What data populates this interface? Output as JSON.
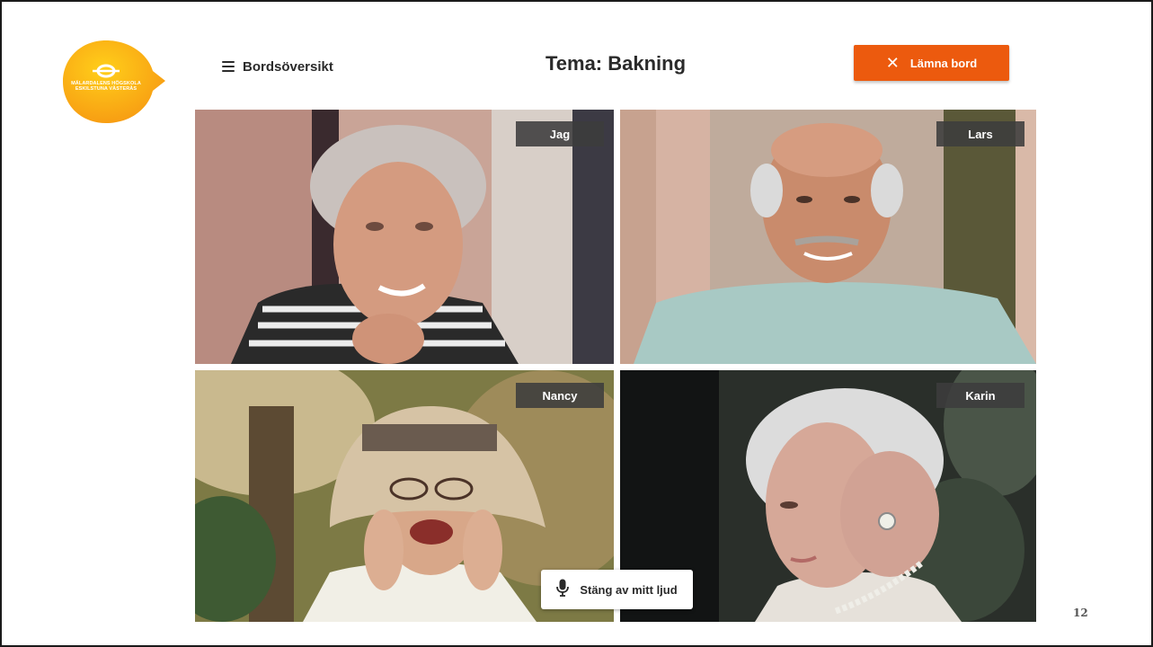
{
  "logo": {
    "text": "MÄLARDALENS HÖGSKOLA ESKILSTUNA VÄSTERÅS",
    "color": "#f7a41d"
  },
  "header": {
    "menu_icon": "hamburger-icon",
    "menu_label": "Bordsöversikt",
    "title": "Tema: Bakning",
    "leave_icon": "close-icon",
    "leave_label": "Lämna bord",
    "accent": "#ec5a0e"
  },
  "participants": [
    {
      "name": "Jag"
    },
    {
      "name": "Lars"
    },
    {
      "name": "Nancy"
    },
    {
      "name": "Karin"
    }
  ],
  "controls": {
    "mute_icon": "microphone-icon",
    "mute_label": "Stäng av mitt ljud"
  },
  "page_number": "12"
}
